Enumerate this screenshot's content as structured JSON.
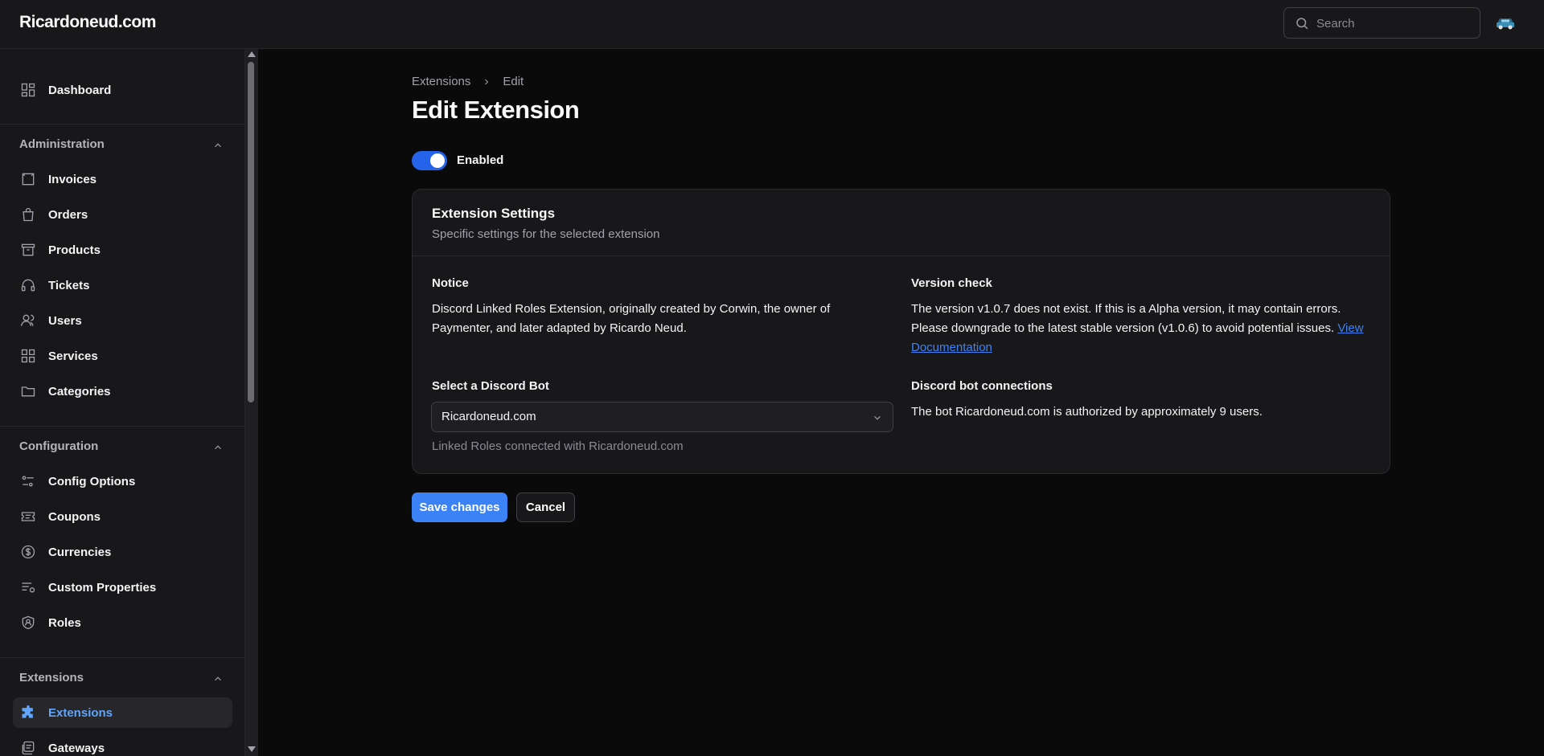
{
  "app": {
    "brand": "Ricardoneud.com"
  },
  "search": {
    "placeholder": "Search"
  },
  "sidebar": {
    "dashboard": "Dashboard",
    "groups": {
      "administration": "Administration",
      "configuration": "Configuration",
      "extensions": "Extensions"
    },
    "administration_items": [
      "Invoices",
      "Orders",
      "Products",
      "Tickets",
      "Users",
      "Services",
      "Categories"
    ],
    "configuration_items": [
      "Config Options",
      "Coupons",
      "Currencies",
      "Custom Properties",
      "Roles"
    ],
    "extensions_items": [
      "Extensions",
      "Gateways"
    ],
    "active_item": "Extensions",
    "active_color": "#60a5fa"
  },
  "breadcrumb": {
    "parent": "Extensions",
    "current": "Edit"
  },
  "page": {
    "title": "Edit Extension"
  },
  "toggle": {
    "label": "Enabled",
    "checked": true,
    "color": "#2563eb"
  },
  "card": {
    "title": "Extension Settings",
    "subtitle": "Specific settings for the selected extension",
    "notice": {
      "label": "Notice",
      "text": "Discord Linked Roles Extension, originally created by Corwin, the owner of Paymenter, and later adapted by Ricardo Neud."
    },
    "version_check": {
      "label": "Version check",
      "text": "The version v1.0.7 does not exist. If this is a Alpha version, it may contain errors. Please downgrade to the latest stable version (v1.0.6) to avoid potential issues.",
      "link": "View Documentation"
    },
    "bot_select": {
      "label": "Select a Discord Bot",
      "value": "Ricardoneud.com",
      "helper": "Linked Roles connected with Ricardoneud.com"
    },
    "bot_connections": {
      "label": "Discord bot connections",
      "text": "The bot Ricardoneud.com is authorized by approximately 9 users."
    }
  },
  "actions": {
    "save": "Save changes",
    "cancel": "Cancel",
    "primary_color": "#3b82f6"
  }
}
